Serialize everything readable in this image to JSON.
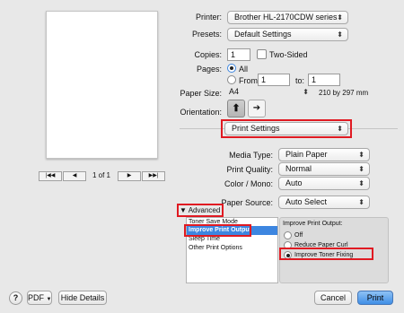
{
  "printer": {
    "label": "Printer:",
    "value": "Brother HL-2170CDW series"
  },
  "presets": {
    "label": "Presets:",
    "value": "Default Settings"
  },
  "copies": {
    "label": "Copies:",
    "value": "1",
    "two_sided": "Two-Sided"
  },
  "pages": {
    "label": "Pages:",
    "all": "All",
    "from": "From:",
    "from_value": "1",
    "to": "to:",
    "to_value": "1"
  },
  "paper_size": {
    "label": "Paper Size:",
    "value": "A4",
    "dims": "210 by 297 mm"
  },
  "orientation": {
    "label": "Orientation:"
  },
  "section": {
    "value": "Print Settings"
  },
  "media_type": {
    "label": "Media Type:",
    "value": "Plain Paper"
  },
  "print_quality": {
    "label": "Print Quality:",
    "value": "Normal"
  },
  "color_mono": {
    "label": "Color / Mono:",
    "value": "Auto"
  },
  "paper_source": {
    "label": "Paper Source:",
    "value": "Auto Select"
  },
  "advanced": {
    "label": "Advanced",
    "list": [
      "Toner Save Mode",
      "Improve Print Output",
      "Sleep Time",
      "Other Print Options"
    ],
    "selected_index": 1
  },
  "improve": {
    "title": "Improve Print Output:",
    "options": [
      "Off",
      "Reduce Paper Curl",
      "Improve Toner Fixing"
    ],
    "selected_index": 2
  },
  "preview": {
    "page_counter": "1 of 1"
  },
  "footer": {
    "help": "?",
    "pdf": "PDF",
    "hide_details": "Hide Details",
    "cancel": "Cancel",
    "print": "Print"
  },
  "colors": {
    "accent": "#3d86e0",
    "highlight": "#e01a22"
  }
}
